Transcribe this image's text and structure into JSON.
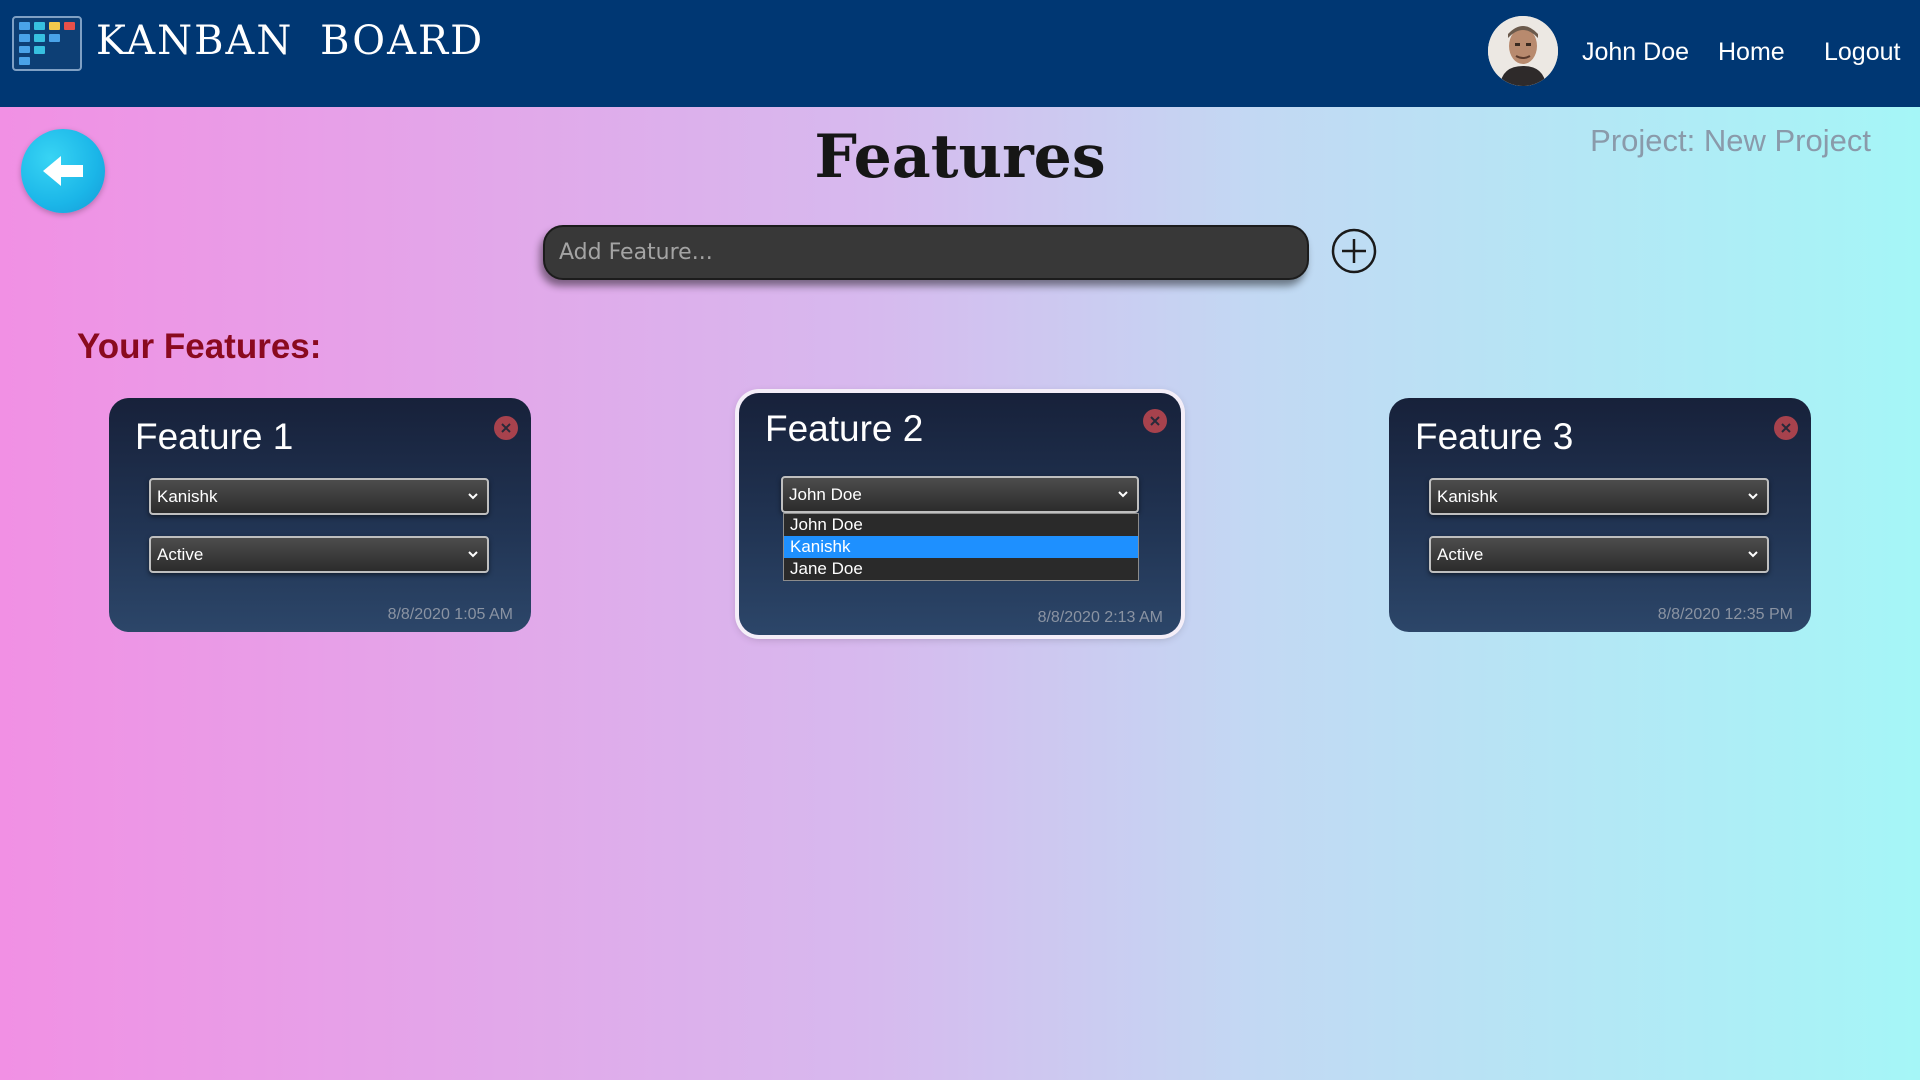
{
  "app": {
    "brand": "KANBAN BOARD"
  },
  "nav": {
    "user_name": "John Doe",
    "home": "Home",
    "logout": "Logout"
  },
  "page": {
    "title": "Features",
    "project": "Project: New Project",
    "add_placeholder": "Add Feature...",
    "section_heading": "Your Features:"
  },
  "cards": [
    {
      "title": "Feature 1",
      "assignee": "Kanishk",
      "status": "Active",
      "timestamp": "8/8/2020 1:05 AM"
    },
    {
      "title": "Feature 2",
      "assignee": "John Doe",
      "timestamp": "8/8/2020 2:13 AM",
      "dropdown_options": [
        "John Doe",
        "Kanishk",
        "Jane Doe"
      ],
      "highlighted_option": "Kanishk"
    },
    {
      "title": "Feature 3",
      "assignee": "Kanishk",
      "status": "Active",
      "timestamp": "8/8/2020 12:35 PM"
    }
  ],
  "colors": {
    "navbar": "#003773",
    "section_heading": "#8a0a1f",
    "close_button": "#a7424d",
    "highlight": "#1e90ff",
    "back_button": "#1bb6e8"
  },
  "icons": {
    "logo": "kanban-board-icon",
    "back": "arrow-left-icon",
    "add": "plus-circle-icon",
    "close": "close-icon",
    "dropdown": "chevron-down-icon"
  }
}
